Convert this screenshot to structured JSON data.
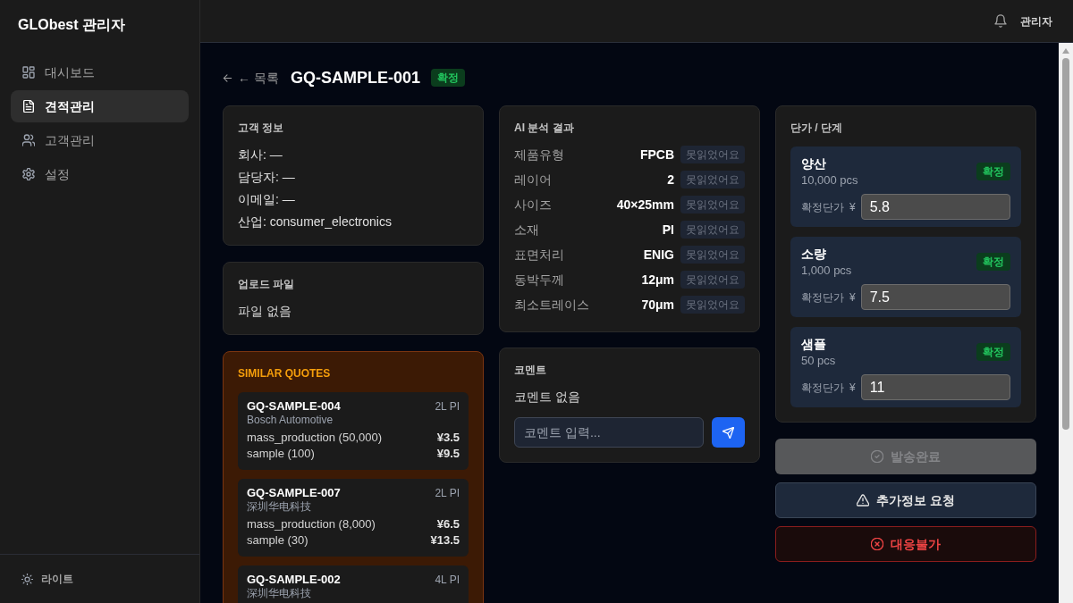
{
  "sidebar": {
    "title": "GLObest 관리자",
    "items": [
      {
        "label": "대시보드",
        "selected": false
      },
      {
        "label": "견적관리",
        "selected": true
      },
      {
        "label": "고객관리",
        "selected": false
      },
      {
        "label": "설정",
        "selected": false
      }
    ],
    "theme_toggle": {
      "label": "라이트"
    }
  },
  "top_bar": {
    "user": "관리자"
  },
  "header": {
    "back_link": "← 목록",
    "title": "GQ-SAMPLE-001",
    "status": "확정"
  },
  "customer_info": {
    "heading": "고객 정보",
    "fields": [
      "회사: —",
      "담당자: —",
      "이메일: —",
      "산업: consumer_electronics"
    ]
  },
  "uploaded_files": {
    "heading": "업로드 파일",
    "empty_text": "파일 없음"
  },
  "similar_quotes": {
    "heading": "SIMILAR QUOTES",
    "quotes": [
      {
        "id": "GQ-SAMPLE-004",
        "spec": "2L PI",
        "company": "Bosch Automotive",
        "tiers": [
          {
            "label": "mass_production (50,000)",
            "price": "¥3.5"
          },
          {
            "label": "sample (100)",
            "price": "¥9.5"
          }
        ]
      },
      {
        "id": "GQ-SAMPLE-007",
        "spec": "2L PI",
        "company": "深圳华电科技",
        "tiers": [
          {
            "label": "mass_production (8,000)",
            "price": "¥6.5"
          },
          {
            "label": "sample (30)",
            "price": "¥13.5"
          }
        ]
      },
      {
        "id": "GQ-SAMPLE-002",
        "spec": "4L PI",
        "company": "深圳华电科技"
      }
    ]
  },
  "ai_analysis": {
    "heading": "AI 분석 결과",
    "rows": [
      {
        "label": "제품유형",
        "value": "FPCB",
        "badge": "못읽었어요"
      },
      {
        "label": "레이어",
        "value": "2",
        "badge": "못읽었어요"
      },
      {
        "label": "사이즈",
        "value": "40×25mm",
        "badge": "못읽었어요"
      },
      {
        "label": "소재",
        "value": "PI",
        "badge": "못읽었어요"
      },
      {
        "label": "표면처리",
        "value": "ENIG",
        "badge": "못읽었어요"
      },
      {
        "label": "동박두께",
        "value": "12μm",
        "badge": "못읽었어요"
      },
      {
        "label": "최소트레이스",
        "value": "70μm",
        "badge": "못읽었어요"
      }
    ]
  },
  "comments": {
    "heading": "코멘트",
    "empty_text": "코멘트 없음",
    "input": {
      "placeholder": "코멘트 입력..."
    }
  },
  "pricing": {
    "heading": "단가 / 단계",
    "tiers": [
      {
        "name": "양산",
        "quantity": "10,000 pcs",
        "status": "확정",
        "price_label": "확정단가",
        "currency": "¥",
        "price": "5.8"
      },
      {
        "name": "소량",
        "quantity": "1,000 pcs",
        "status": "확정",
        "price_label": "확정단가",
        "currency": "¥",
        "price": "7.5"
      },
      {
        "name": "샘플",
        "quantity": "50 pcs",
        "status": "확정",
        "price_label": "확정단가",
        "currency": "¥",
        "price": "11"
      }
    ]
  },
  "actions": [
    {
      "label": "발송완료",
      "kind": "neutral",
      "disabled": true
    },
    {
      "label": "추가정보 요청",
      "kind": "secondary",
      "disabled": false
    },
    {
      "label": "대응불가",
      "kind": "danger",
      "disabled": false
    }
  ]
}
